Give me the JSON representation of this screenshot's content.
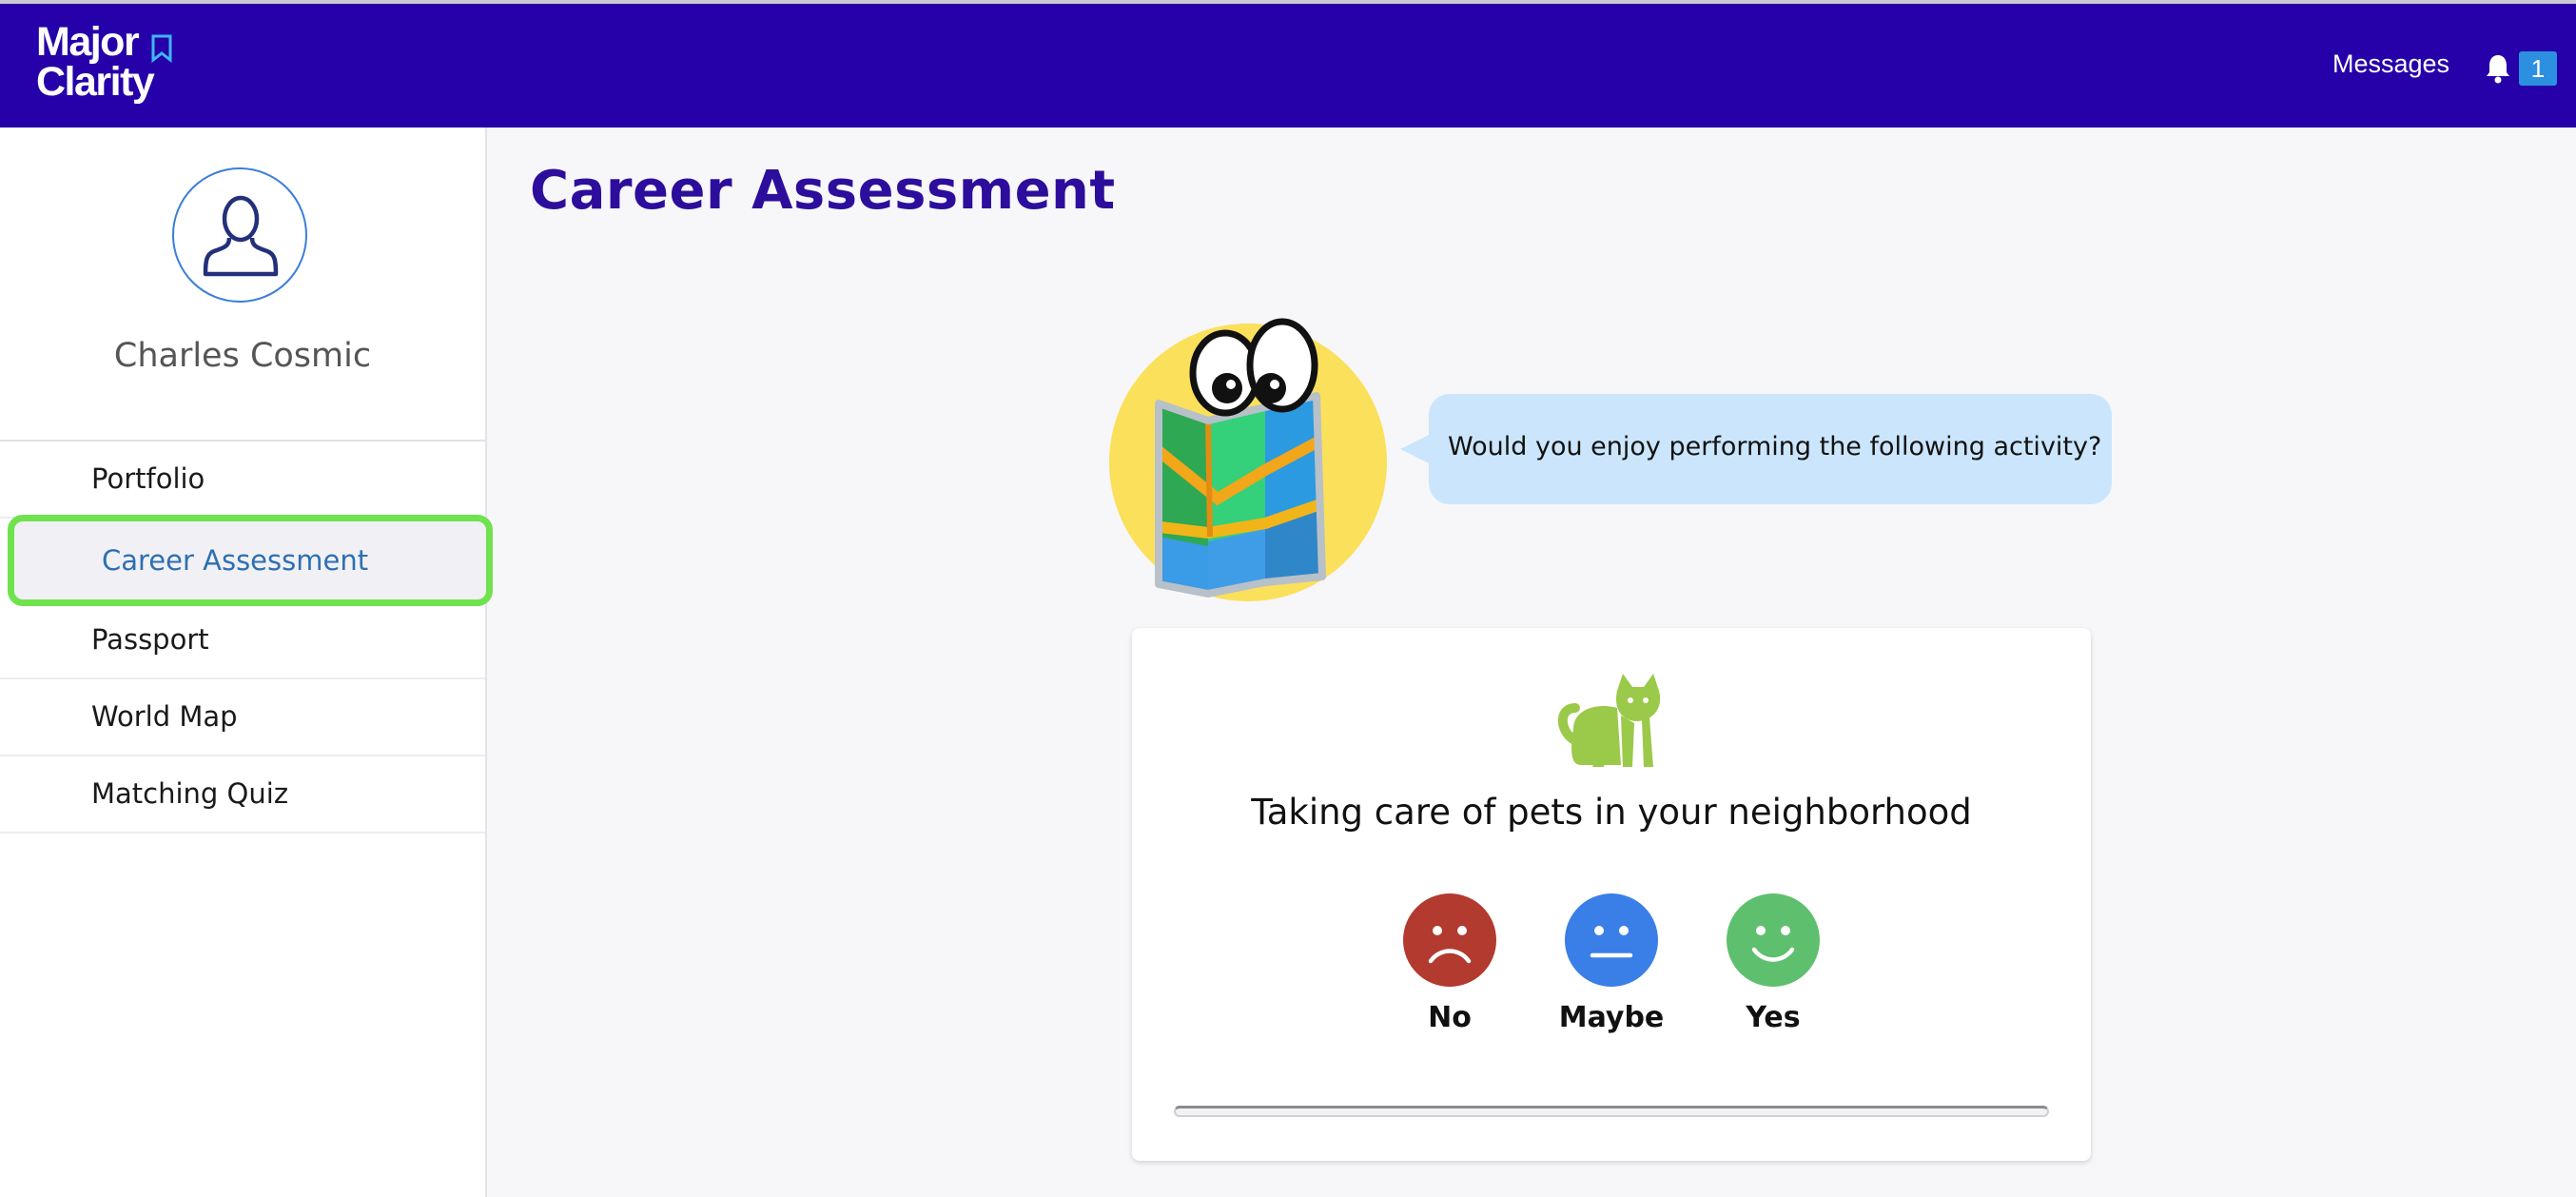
{
  "header": {
    "logo_line1": "Major",
    "logo_line2": "Clarity",
    "messages_label": "Messages",
    "notification_count": "1",
    "background_color": "#2600a8"
  },
  "sidebar": {
    "user_name": "Charles Cosmic",
    "items": [
      {
        "label": "Portfolio",
        "active": false
      },
      {
        "label": "Career Assessment",
        "active": true
      },
      {
        "label": "Passport",
        "active": false
      },
      {
        "label": "World Map",
        "active": false
      },
      {
        "label": "Matching Quiz",
        "active": false
      }
    ]
  },
  "main": {
    "title": "Career Assessment",
    "prompt": "Would you enjoy performing the following activity?",
    "activity": "Taking care of pets in your neighborhood",
    "activity_icon": "cat-icon",
    "choices": [
      {
        "label": "No",
        "icon": "sad-face-icon",
        "color": "#b23a2e"
      },
      {
        "label": "Maybe",
        "icon": "neutral-face-icon",
        "color": "#3a7ee8"
      },
      {
        "label": "Yes",
        "icon": "happy-face-icon",
        "color": "#5ec06e"
      }
    ],
    "progress_fraction": 0.0
  }
}
